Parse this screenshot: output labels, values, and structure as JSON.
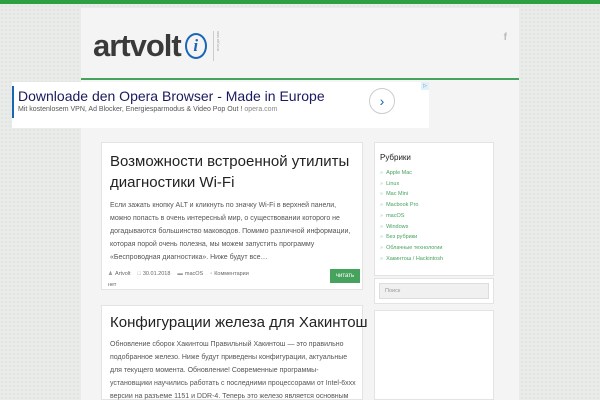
{
  "header": {
    "logo_text": "artvolt",
    "logo_badge": "i",
    "logo_tagline": "всегда мак",
    "social_icon": "facebook-icon"
  },
  "ad": {
    "title": "Downloade den Opera Browser - Made in Europe",
    "subtitle": "Mit kostenlosem VPN, Ad Blocker, Energiesparmodus & Video Pop Out !",
    "url": "opera.com",
    "arrow": "›",
    "choice_icon": "adchoices-icon"
  },
  "posts": [
    {
      "title": "Возможности встроенной утилиты диагностики Wi-Fi",
      "excerpt": "Если зажать кнопку ALT и кликнуть по значку Wi-Fi в верхней панели, можно попасть в очень интересный мир, о существовании которого не догадываются большинство маководов. Помимо различной информации, которая порой очень полезна, мы можем запустить программу «Беспроводная диагностика». Ниже будут все…",
      "author": "Artvolt",
      "date": "30.01.2018",
      "category": "macOS",
      "comments": "Комментарии",
      "comments_extra": "нет",
      "read_label": "читать"
    },
    {
      "title": "Конфигурации железа для Хакинтош",
      "excerpt": "Обновление сборок Хакинтош   Правильный Хакинтош — это правильно подобранное железо. Ниже будут приведены конфигурации, актуальные для текущего момента. Обновление! Современные программы-установщики научились работать с последними процессорами от Intel-6xxx версии на разъеме 1151 и DDR-4. Теперь это железо является основным рекомендуемым! Пример…"
    }
  ],
  "sidebar": {
    "rubrics_title": "Рубрики",
    "categories": [
      "Apple Mac",
      "Linux",
      "Mac Mini",
      "Macbook Pro",
      "macOS",
      "Windows",
      "Без рубрики",
      "Облачные технологии",
      "Хакинтош / Hackintosh"
    ],
    "search_placeholder": "Поиск"
  },
  "colors": {
    "accent": "#46a35e",
    "logo_blue": "#1a66b5"
  }
}
